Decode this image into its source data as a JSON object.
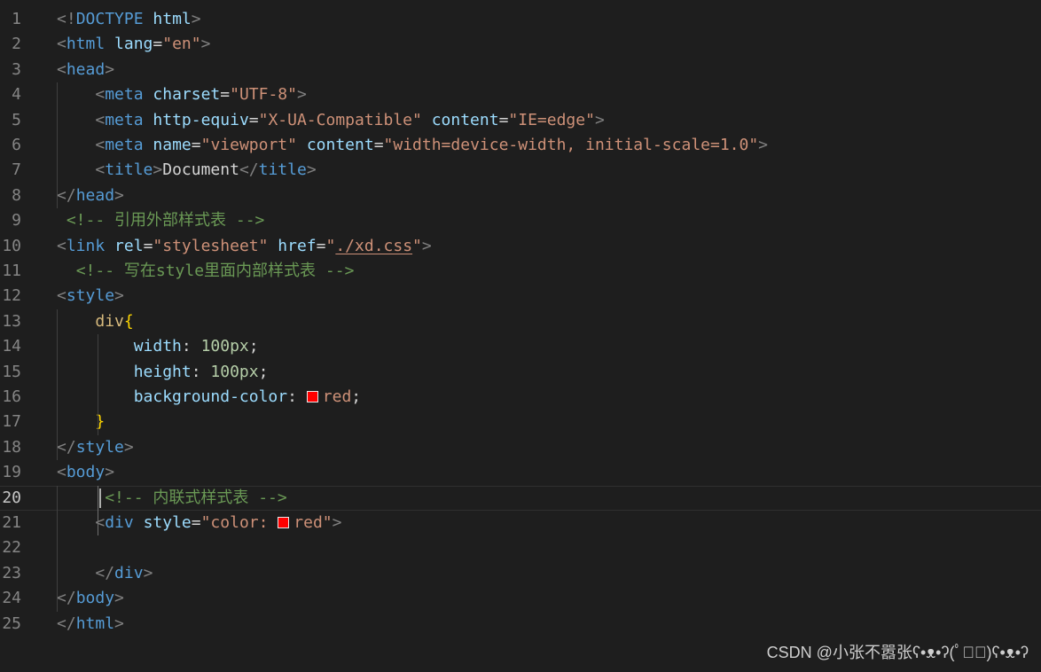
{
  "editor": {
    "current_line": 20,
    "swatch_color": "#ff0000",
    "lines": [
      {
        "num": "1",
        "tokens": [
          {
            "c": "t-punc",
            "t": "<!"
          },
          {
            "c": "t-tag",
            "t": "DOCTYPE"
          },
          {
            "c": "t-text",
            "t": " "
          },
          {
            "c": "t-attr",
            "t": "html"
          },
          {
            "c": "t-punc",
            "t": ">"
          }
        ]
      },
      {
        "num": "2",
        "tokens": [
          {
            "c": "t-punc",
            "t": "<"
          },
          {
            "c": "t-tag",
            "t": "html"
          },
          {
            "c": "t-text",
            "t": " "
          },
          {
            "c": "t-attr",
            "t": "lang"
          },
          {
            "c": "t-text",
            "t": "="
          },
          {
            "c": "t-str",
            "t": "\"en\""
          },
          {
            "c": "t-punc",
            "t": ">"
          }
        ]
      },
      {
        "num": "3",
        "tokens": [
          {
            "c": "t-punc",
            "t": "<"
          },
          {
            "c": "t-tag",
            "t": "head"
          },
          {
            "c": "t-punc",
            "t": ">"
          }
        ]
      },
      {
        "num": "4",
        "tokens": [
          {
            "c": "t-text",
            "t": "    "
          },
          {
            "c": "t-punc",
            "t": "<"
          },
          {
            "c": "t-tag",
            "t": "meta"
          },
          {
            "c": "t-text",
            "t": " "
          },
          {
            "c": "t-attr",
            "t": "charset"
          },
          {
            "c": "t-text",
            "t": "="
          },
          {
            "c": "t-str",
            "t": "\"UTF-8\""
          },
          {
            "c": "t-punc",
            "t": ">"
          }
        ]
      },
      {
        "num": "5",
        "tokens": [
          {
            "c": "t-text",
            "t": "    "
          },
          {
            "c": "t-punc",
            "t": "<"
          },
          {
            "c": "t-tag",
            "t": "meta"
          },
          {
            "c": "t-text",
            "t": " "
          },
          {
            "c": "t-attr",
            "t": "http-equiv"
          },
          {
            "c": "t-text",
            "t": "="
          },
          {
            "c": "t-str",
            "t": "\"X-UA-Compatible\""
          },
          {
            "c": "t-text",
            "t": " "
          },
          {
            "c": "t-attr",
            "t": "content"
          },
          {
            "c": "t-text",
            "t": "="
          },
          {
            "c": "t-str",
            "t": "\"IE=edge\""
          },
          {
            "c": "t-punc",
            "t": ">"
          }
        ]
      },
      {
        "num": "6",
        "tokens": [
          {
            "c": "t-text",
            "t": "    "
          },
          {
            "c": "t-punc",
            "t": "<"
          },
          {
            "c": "t-tag",
            "t": "meta"
          },
          {
            "c": "t-text",
            "t": " "
          },
          {
            "c": "t-attr",
            "t": "name"
          },
          {
            "c": "t-text",
            "t": "="
          },
          {
            "c": "t-str",
            "t": "\"viewport\""
          },
          {
            "c": "t-text",
            "t": " "
          },
          {
            "c": "t-attr",
            "t": "content"
          },
          {
            "c": "t-text",
            "t": "="
          },
          {
            "c": "t-str",
            "t": "\"width=device-width, initial-scale=1.0\""
          },
          {
            "c": "t-punc",
            "t": ">"
          }
        ]
      },
      {
        "num": "7",
        "tokens": [
          {
            "c": "t-text",
            "t": "    "
          },
          {
            "c": "t-punc",
            "t": "<"
          },
          {
            "c": "t-tag",
            "t": "title"
          },
          {
            "c": "t-punc",
            "t": ">"
          },
          {
            "c": "t-text",
            "t": "Document"
          },
          {
            "c": "t-punc",
            "t": "</"
          },
          {
            "c": "t-tag",
            "t": "title"
          },
          {
            "c": "t-punc",
            "t": ">"
          }
        ]
      },
      {
        "num": "8",
        "tokens": [
          {
            "c": "t-punc",
            "t": "</"
          },
          {
            "c": "t-tag",
            "t": "head"
          },
          {
            "c": "t-punc",
            "t": ">"
          }
        ]
      },
      {
        "num": "9",
        "tokens": [
          {
            "c": "t-text",
            "t": " "
          },
          {
            "c": "t-com",
            "t": "<!-- 引用外部样式表 -->"
          }
        ]
      },
      {
        "num": "10",
        "tokens": [
          {
            "c": "t-punc",
            "t": "<"
          },
          {
            "c": "t-tag",
            "t": "link"
          },
          {
            "c": "t-text",
            "t": " "
          },
          {
            "c": "t-attr",
            "t": "rel"
          },
          {
            "c": "t-text",
            "t": "="
          },
          {
            "c": "t-str",
            "t": "\"stylesheet\""
          },
          {
            "c": "t-text",
            "t": " "
          },
          {
            "c": "t-attr",
            "t": "href"
          },
          {
            "c": "t-text",
            "t": "="
          },
          {
            "c": "t-str",
            "t": "\""
          },
          {
            "c": "t-str t-link",
            "t": "./xd.css"
          },
          {
            "c": "t-str",
            "t": "\""
          },
          {
            "c": "t-punc",
            "t": ">"
          }
        ]
      },
      {
        "num": "11",
        "tokens": [
          {
            "c": "t-text",
            "t": "  "
          },
          {
            "c": "t-com",
            "t": "<!-- 写在style里面内部样式表 -->"
          }
        ]
      },
      {
        "num": "12",
        "tokens": [
          {
            "c": "t-punc",
            "t": "<"
          },
          {
            "c": "t-tag",
            "t": "style"
          },
          {
            "c": "t-punc",
            "t": ">"
          }
        ]
      },
      {
        "num": "13",
        "tokens": [
          {
            "c": "t-text",
            "t": "    "
          },
          {
            "c": "t-sel",
            "t": "div"
          },
          {
            "c": "t-brace",
            "t": "{"
          }
        ]
      },
      {
        "num": "14",
        "tokens": [
          {
            "c": "t-text",
            "t": "        "
          },
          {
            "c": "t-attr",
            "t": "width"
          },
          {
            "c": "t-text",
            "t": ": "
          },
          {
            "c": "t-num",
            "t": "100px"
          },
          {
            "c": "t-text",
            "t": ";"
          }
        ]
      },
      {
        "num": "15",
        "tokens": [
          {
            "c": "t-text",
            "t": "        "
          },
          {
            "c": "t-attr",
            "t": "height"
          },
          {
            "c": "t-text",
            "t": ": "
          },
          {
            "c": "t-num",
            "t": "100px"
          },
          {
            "c": "t-text",
            "t": ";"
          }
        ]
      },
      {
        "num": "16",
        "tokens": [
          {
            "c": "t-text",
            "t": "        "
          },
          {
            "c": "t-attr",
            "t": "background-color"
          },
          {
            "c": "t-text",
            "t": ": "
          },
          {
            "c": "swatch",
            "t": ""
          },
          {
            "c": "t-str",
            "t": "red"
          },
          {
            "c": "t-text",
            "t": ";"
          }
        ]
      },
      {
        "num": "17",
        "tokens": [
          {
            "c": "t-text",
            "t": "    "
          },
          {
            "c": "t-brace",
            "t": "}"
          }
        ]
      },
      {
        "num": "18",
        "tokens": [
          {
            "c": "t-punc",
            "t": "</"
          },
          {
            "c": "t-tag",
            "t": "style"
          },
          {
            "c": "t-punc",
            "t": ">"
          }
        ]
      },
      {
        "num": "19",
        "tokens": [
          {
            "c": "t-punc",
            "t": "<"
          },
          {
            "c": "t-tag",
            "t": "body"
          },
          {
            "c": "t-punc",
            "t": ">"
          }
        ]
      },
      {
        "num": "20",
        "tokens": [
          {
            "c": "t-text",
            "t": "     "
          },
          {
            "c": "t-com",
            "t": "<!-- 内联式样式表 -->"
          }
        ]
      },
      {
        "num": "21",
        "tokens": [
          {
            "c": "t-text",
            "t": "    "
          },
          {
            "c": "t-punc",
            "t": "<"
          },
          {
            "c": "t-tag",
            "t": "div"
          },
          {
            "c": "t-text",
            "t": " "
          },
          {
            "c": "t-attr",
            "t": "style"
          },
          {
            "c": "t-text",
            "t": "="
          },
          {
            "c": "t-str",
            "t": "\"color: "
          },
          {
            "c": "swatch",
            "t": ""
          },
          {
            "c": "t-str",
            "t": "red\""
          },
          {
            "c": "t-punc",
            "t": ">"
          }
        ]
      },
      {
        "num": "22",
        "tokens": []
      },
      {
        "num": "23",
        "tokens": [
          {
            "c": "t-text",
            "t": "    "
          },
          {
            "c": "t-punc",
            "t": "</"
          },
          {
            "c": "t-tag",
            "t": "div"
          },
          {
            "c": "t-punc",
            "t": ">"
          }
        ]
      },
      {
        "num": "24",
        "tokens": [
          {
            "c": "t-punc",
            "t": "</"
          },
          {
            "c": "t-tag",
            "t": "body"
          },
          {
            "c": "t-punc",
            "t": ">"
          }
        ]
      },
      {
        "num": "25",
        "tokens": [
          {
            "c": "t-punc",
            "t": "</"
          },
          {
            "c": "t-tag",
            "t": "html"
          },
          {
            "c": "t-punc",
            "t": ">"
          }
        ]
      }
    ]
  },
  "watermark": "CSDN @小张不嚣张ʕ•ᴥ•ʔ(ﾟ⅄ﾟ)ʕ•ᴥ•ʔ"
}
